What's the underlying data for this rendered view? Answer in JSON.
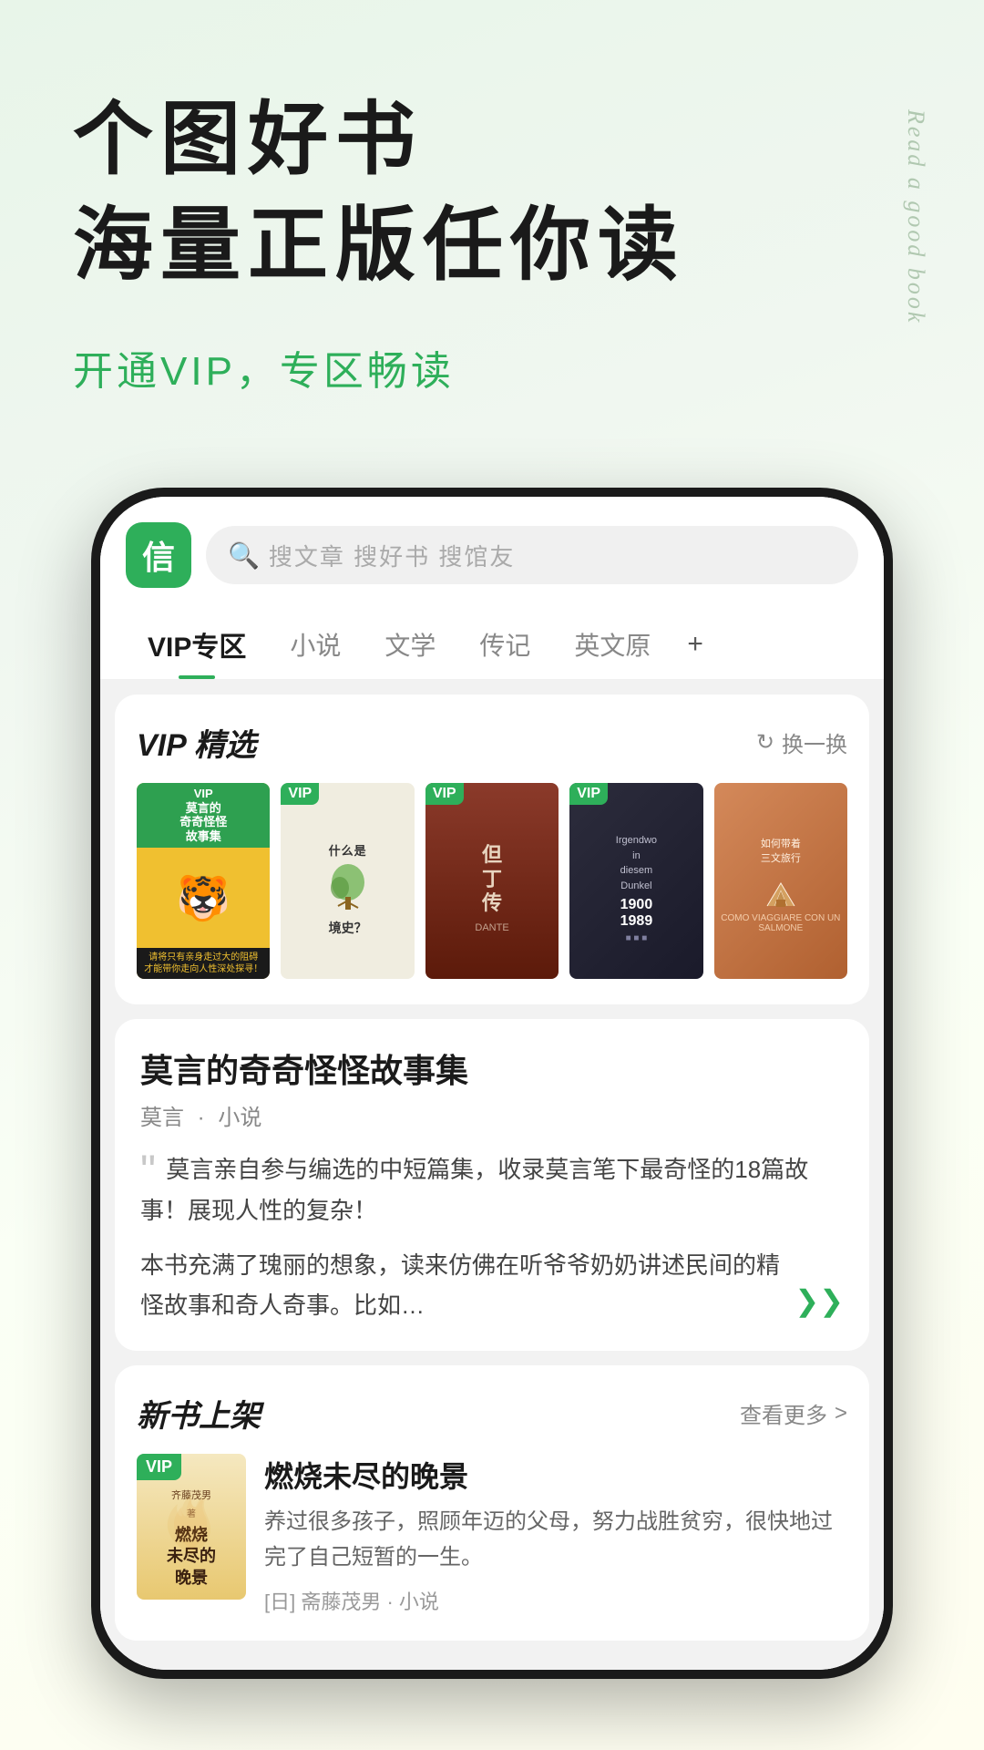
{
  "hero": {
    "title_main": "个图好书",
    "title_sub": "海量正版任你读",
    "vip_text": "开通VIP，专区畅读",
    "side_text": "Read a good book"
  },
  "app": {
    "logo_char": "信",
    "search_placeholder": "搜文章  搜好书  搜馆友"
  },
  "nav": {
    "tabs": [
      {
        "label": "VIP专区",
        "active": true
      },
      {
        "label": "小说",
        "active": false
      },
      {
        "label": "文学",
        "active": false
      },
      {
        "label": "传记",
        "active": false
      },
      {
        "label": "英文原",
        "active": false
      }
    ],
    "plus_label": "+"
  },
  "vip_section": {
    "title": "VIP 精选",
    "action_label": "换一换",
    "books": [
      {
        "title": "莫言的奇奇怪怪故事集",
        "type": "vip",
        "cover": "tiger"
      },
      {
        "title": "什么是境史?",
        "type": "vip",
        "cover": "tree"
      },
      {
        "title": "但丁传",
        "type": "vip",
        "cover": "dante"
      },
      {
        "title": "Irgendwo in diesem Dunkel 1900 1989",
        "type": "vip",
        "cover": "dark"
      },
      {
        "title": "如何带着三文旅行",
        "type": "vip",
        "cover": "travel"
      }
    ]
  },
  "book_desc": {
    "title": "莫言的奇奇怪怪故事集",
    "author": "莫言",
    "genre": "小说",
    "quote1": "莫言亲自参与编选的中短篇集，收录莫言笔下最奇怪的18篇故事！展现人性的复杂！",
    "quote2": "本书充满了瑰丽的想象，读来仿佛在听爷爷奶奶讲述民间的精怪故事和奇人奇事。比如…"
  },
  "new_books": {
    "section_title": "新书上架",
    "see_more": "查看更多",
    "chevron": ">",
    "book": {
      "title": "燃烧未尽的晚景",
      "desc": "养过很多孩子，照顾年迈的父母，努力战胜贫穷，很快地过完了自己短暂的一生。",
      "author": "[日] 斋藤茂男",
      "genre": "小说",
      "vip": true
    }
  }
}
